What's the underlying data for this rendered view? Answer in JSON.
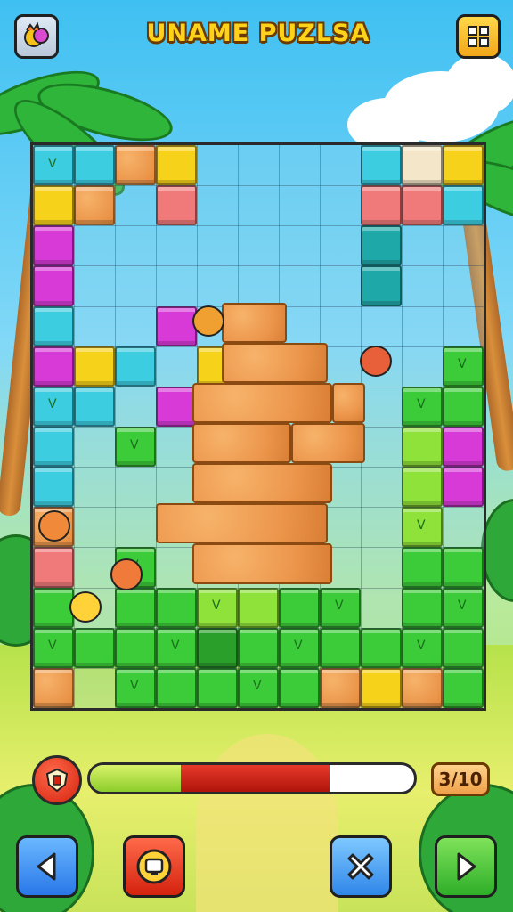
{
  "header": {
    "title": "UNAME PUZLSA",
    "menu_icon": "character-badge-icon",
    "settings_icon": "puzzle-grid-icon"
  },
  "status": {
    "progress_fraction": 0.74,
    "score_text": "3/10"
  },
  "controls": {
    "left_icon": "arrow-left-icon",
    "center_icon": "coin-icon",
    "cross_icon": "cross-icon",
    "right_icon": "arrow-right-icon"
  },
  "colors": {
    "title": "#ffd21a",
    "brick": "#ec964c",
    "green": "#3ccc3a",
    "magenta": "#d83ad8",
    "cyan": "#3ccde0",
    "yellow": "#f7d21a",
    "salmon": "#f07a7a",
    "progress_red": "#c81a10"
  }
}
